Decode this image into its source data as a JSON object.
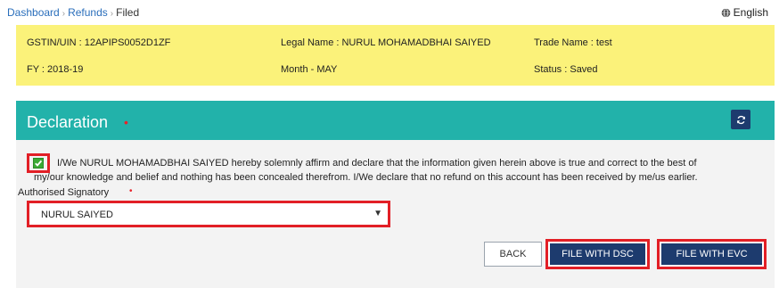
{
  "breadcrumb": {
    "items": [
      "Dashboard",
      "Refunds"
    ],
    "current": "Filed",
    "separator": "›"
  },
  "language": {
    "label": "English",
    "icon": "globe-icon"
  },
  "info": {
    "gstin": "GSTIN/UIN : 12APIPS0052D1ZF",
    "legal_name": "Legal Name : NURUL MOHAMADBHAI SAIYED",
    "trade_name": "Trade Name : test",
    "fy": "FY : 2018-19",
    "month": "Month - MAY",
    "status": "Status : Saved"
  },
  "declaration": {
    "title": "Declaration",
    "required_mark": "•",
    "refresh_icon": "refresh-icon",
    "checked": true,
    "text_line1": "I/We NURUL MOHAMADBHAI SAIYED hereby solemnly affirm and declare that the information given herein above is true and correct to the best of",
    "text_line2": "my/our knowledge and belief and nothing has been concealed therefrom. I/We declare that no refund on this account has been received by me/us earlier.",
    "authorised_label": "Authorised Signatory",
    "authorised_value": "NURUL SAIYED",
    "dropdown_arrow": "▼"
  },
  "buttons": {
    "back": "BACK",
    "file_dsc": "FILE WITH DSC",
    "file_evc": "FILE WITH EVC"
  },
  "colors": {
    "link": "#2a6ebb",
    "info_bg": "#fbf27a",
    "panel_header": "#22b2aa",
    "primary_button": "#1d3b6e",
    "highlight": "#e21f26",
    "checkbox": "#3aaa35"
  }
}
